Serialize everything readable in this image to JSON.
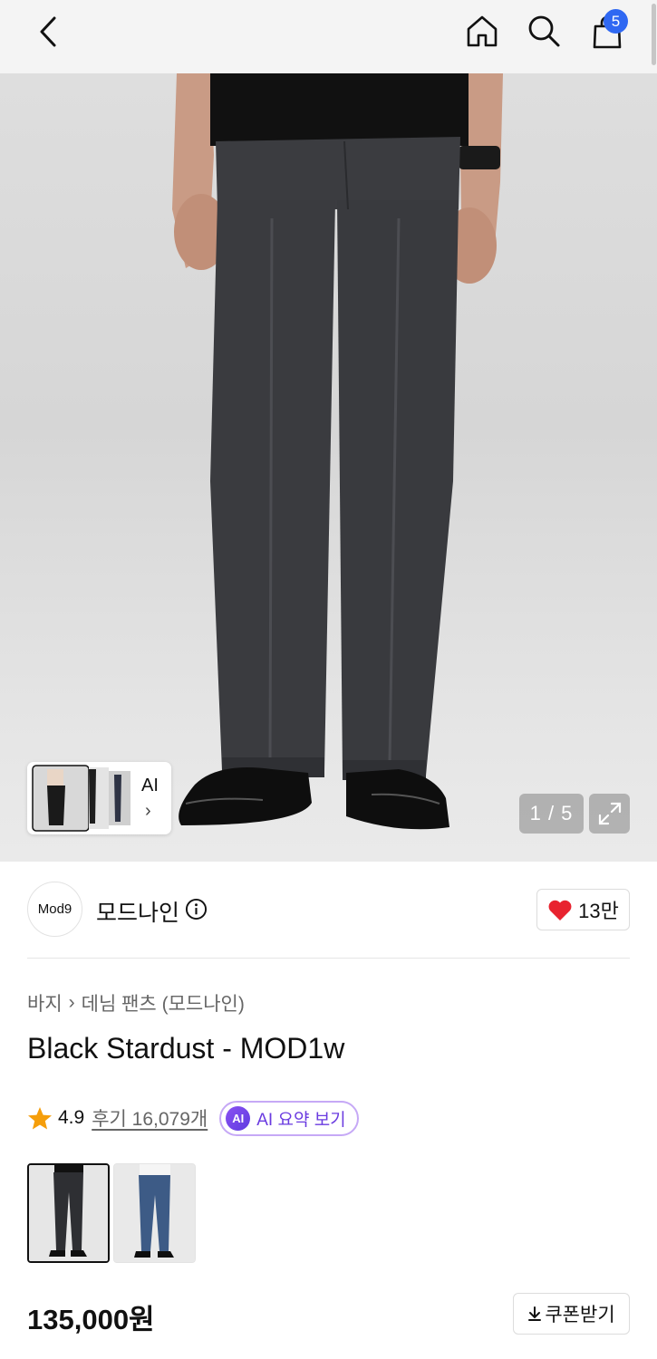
{
  "header": {
    "icons": [
      "back-icon",
      "home-icon",
      "search-icon",
      "shopping-bag-icon"
    ],
    "cart_count": "5"
  },
  "gallery": {
    "ai_label": "AI",
    "page_indicator": "1 / 5",
    "current_page": 1,
    "total_pages": 5
  },
  "brand": {
    "logo_text": "Mod9",
    "name": "모드나인",
    "like_count": "13만"
  },
  "product": {
    "breadcrumb": [
      "바지",
      "데님 팬츠 (모드나인)"
    ],
    "title": "Black Stardust - MOD1w",
    "rating": "4.9",
    "review_link": "후기 16,079개",
    "ai_badge": "AI",
    "ai_summary": "AI 요약 보기",
    "price": "135,000원",
    "coupon_button": "쿠폰받기"
  },
  "colors": {
    "accent_blue": "#2f68f2",
    "like_red": "#e8232f",
    "star": "#f59e0b",
    "ai_purple": "#6a3be0"
  }
}
